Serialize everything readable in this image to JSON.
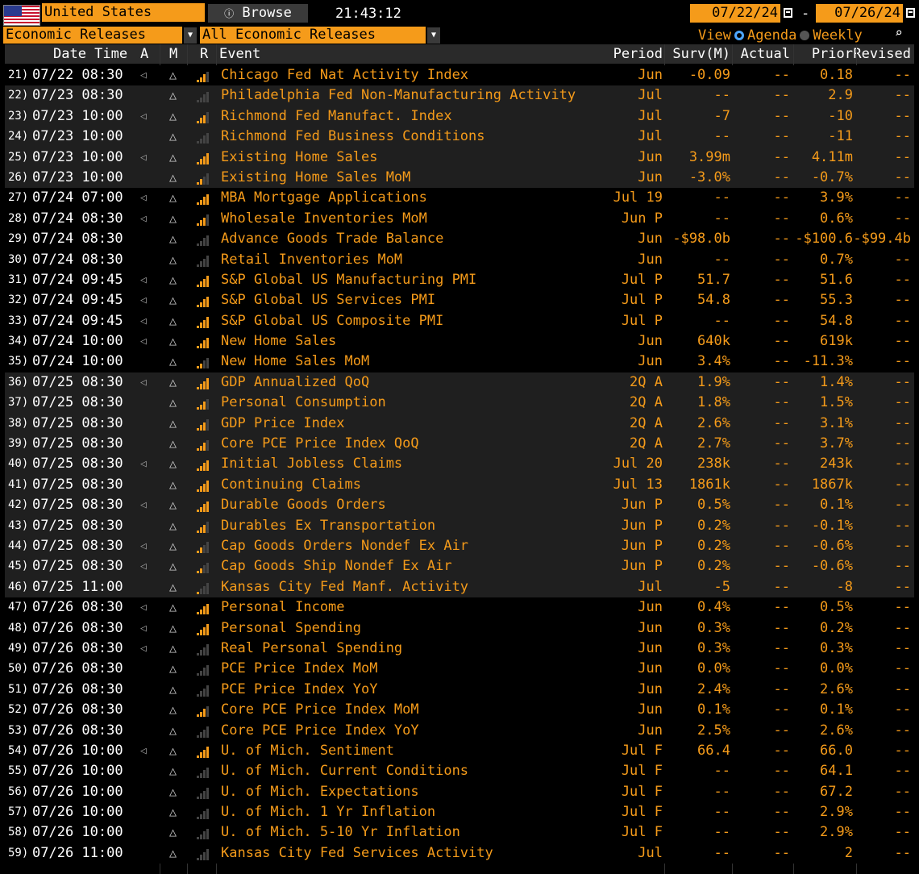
{
  "top": {
    "country": "United States",
    "browse_label": "Browse",
    "browse_icon": "info-icon",
    "time": "21:43:12",
    "date_from": "07/22/24",
    "date_sep": "-",
    "date_to": "07/26/24"
  },
  "filters": {
    "category": "Economic Releases",
    "subcategory": "All Economic Releases",
    "view_label": "View",
    "agenda_label": "Agenda",
    "weekly_label": "Weekly",
    "view_selected": "Agenda"
  },
  "columns": {
    "datetime": "Date Time",
    "a": "A",
    "m": "M",
    "r": "R",
    "event": "Event",
    "period": "Period",
    "surv": "Surv(M)",
    "actual": "Actual",
    "prior": "Prior",
    "revised": "Revised"
  },
  "rows": [
    {
      "idx": "21)",
      "dt": "07/22 08:30",
      "a": "◁",
      "r": 3,
      "event": "Chicago Fed Nat Activity Index",
      "period": "Jun",
      "surv": "-0.09",
      "actual": "--",
      "prior": "0.18",
      "revised": "--"
    },
    {
      "idx": "22)",
      "dt": "07/23 08:30",
      "a": "",
      "r": 0,
      "event": "Philadelphia Fed Non-Manufacturing Activity",
      "period": "Jul",
      "surv": "--",
      "actual": "--",
      "prior": "2.9",
      "revised": "--"
    },
    {
      "idx": "23)",
      "dt": "07/23 10:00",
      "a": "◁",
      "r": 3,
      "event": "Richmond Fed Manufact. Index",
      "period": "Jul",
      "surv": "-7",
      "actual": "--",
      "prior": "-10",
      "revised": "--"
    },
    {
      "idx": "24)",
      "dt": "07/23 10:00",
      "a": "",
      "r": 0,
      "event": "Richmond Fed Business Conditions",
      "period": "Jul",
      "surv": "--",
      "actual": "--",
      "prior": "-11",
      "revised": "--"
    },
    {
      "idx": "25)",
      "dt": "07/23 10:00",
      "a": "◁",
      "r": 4,
      "event": "Existing Home Sales",
      "period": "Jun",
      "surv": "3.99m",
      "actual": "--",
      "prior": "4.11m",
      "revised": "--"
    },
    {
      "idx": "26)",
      "dt": "07/23 10:00",
      "a": "",
      "r": 2,
      "event": "Existing Home Sales MoM",
      "period": "Jun",
      "surv": "-3.0%",
      "actual": "--",
      "prior": "-0.7%",
      "revised": "--"
    },
    {
      "idx": "27)",
      "dt": "07/24 07:00",
      "a": "◁",
      "r": 4,
      "event": "MBA Mortgage Applications",
      "period": "Jul 19",
      "surv": "--",
      "actual": "--",
      "prior": "3.9%",
      "revised": "--"
    },
    {
      "idx": "28)",
      "dt": "07/24 08:30",
      "a": "◁",
      "r": 3,
      "event": "Wholesale Inventories MoM",
      "period": "Jun P",
      "surv": "--",
      "actual": "--",
      "prior": "0.6%",
      "revised": "--"
    },
    {
      "idx": "29)",
      "dt": "07/24 08:30",
      "a": "",
      "r": 0,
      "event": "Advance Goods Trade Balance",
      "period": "Jun",
      "surv": "-$98.0b",
      "actual": "--",
      "prior": "-$100.6",
      "revised": "-$99.4b"
    },
    {
      "idx": "30)",
      "dt": "07/24 08:30",
      "a": "",
      "r": 0,
      "event": "Retail Inventories MoM",
      "period": "Jun",
      "surv": "--",
      "actual": "--",
      "prior": "0.7%",
      "revised": "--"
    },
    {
      "idx": "31)",
      "dt": "07/24 09:45",
      "a": "◁",
      "r": 4,
      "event": "S&P Global US Manufacturing PMI",
      "period": "Jul P",
      "surv": "51.7",
      "actual": "--",
      "prior": "51.6",
      "revised": "--"
    },
    {
      "idx": "32)",
      "dt": "07/24 09:45",
      "a": "◁",
      "r": 4,
      "event": "S&P Global US Services PMI",
      "period": "Jul P",
      "surv": "54.8",
      "actual": "--",
      "prior": "55.3",
      "revised": "--"
    },
    {
      "idx": "33)",
      "dt": "07/24 09:45",
      "a": "◁",
      "r": 4,
      "event": "S&P Global US Composite PMI",
      "period": "Jul P",
      "surv": "--",
      "actual": "--",
      "prior": "54.8",
      "revised": "--"
    },
    {
      "idx": "34)",
      "dt": "07/24 10:00",
      "a": "◁",
      "r": 4,
      "event": "New Home Sales",
      "period": "Jun",
      "surv": "640k",
      "actual": "--",
      "prior": "619k",
      "revised": "--"
    },
    {
      "idx": "35)",
      "dt": "07/24 10:00",
      "a": "",
      "r": 2,
      "event": "New Home Sales MoM",
      "period": "Jun",
      "surv": "3.4%",
      "actual": "--",
      "prior": "-11.3%",
      "revised": "--"
    },
    {
      "idx": "36)",
      "dt": "07/25 08:30",
      "a": "◁",
      "r": 4,
      "event": "GDP Annualized QoQ",
      "period": "2Q A",
      "surv": "1.9%",
      "actual": "--",
      "prior": "1.4%",
      "revised": "--"
    },
    {
      "idx": "37)",
      "dt": "07/25 08:30",
      "a": "",
      "r": 3,
      "event": "Personal Consumption",
      "period": "2Q A",
      "surv": "1.8%",
      "actual": "--",
      "prior": "1.5%",
      "revised": "--"
    },
    {
      "idx": "38)",
      "dt": "07/25 08:30",
      "a": "",
      "r": 3,
      "event": "GDP Price Index",
      "period": "2Q A",
      "surv": "2.6%",
      "actual": "--",
      "prior": "3.1%",
      "revised": "--"
    },
    {
      "idx": "39)",
      "dt": "07/25 08:30",
      "a": "",
      "r": 3,
      "event": "Core PCE Price Index QoQ",
      "period": "2Q A",
      "surv": "2.7%",
      "actual": "--",
      "prior": "3.7%",
      "revised": "--"
    },
    {
      "idx": "40)",
      "dt": "07/25 08:30",
      "a": "◁",
      "r": 4,
      "event": "Initial Jobless Claims",
      "period": "Jul 20",
      "surv": "238k",
      "actual": "--",
      "prior": "243k",
      "revised": "--"
    },
    {
      "idx": "41)",
      "dt": "07/25 08:30",
      "a": "",
      "r": 4,
      "event": "Continuing Claims",
      "period": "Jul 13",
      "surv": "1861k",
      "actual": "--",
      "prior": "1867k",
      "revised": "--"
    },
    {
      "idx": "42)",
      "dt": "07/25 08:30",
      "a": "◁",
      "r": 4,
      "event": "Durable Goods Orders",
      "period": "Jun P",
      "surv": "0.5%",
      "actual": "--",
      "prior": "0.1%",
      "revised": "--"
    },
    {
      "idx": "43)",
      "dt": "07/25 08:30",
      "a": "",
      "r": 3,
      "event": "Durables Ex Transportation",
      "period": "Jun P",
      "surv": "0.2%",
      "actual": "--",
      "prior": "-0.1%",
      "revised": "--"
    },
    {
      "idx": "44)",
      "dt": "07/25 08:30",
      "a": "◁",
      "r": 2,
      "event": "Cap Goods Orders Nondef Ex Air",
      "period": "Jun P",
      "surv": "0.2%",
      "actual": "--",
      "prior": "-0.6%",
      "revised": "--"
    },
    {
      "idx": "45)",
      "dt": "07/25 08:30",
      "a": "◁",
      "r": 2,
      "event": "Cap Goods Ship Nondef Ex Air",
      "period": "Jun P",
      "surv": "0.2%",
      "actual": "--",
      "prior": "-0.6%",
      "revised": "--"
    },
    {
      "idx": "46)",
      "dt": "07/25 11:00",
      "a": "",
      "r": 1,
      "event": "Kansas City Fed Manf. Activity",
      "period": "Jul",
      "surv": "-5",
      "actual": "--",
      "prior": "-8",
      "revised": "--"
    },
    {
      "idx": "47)",
      "dt": "07/26 08:30",
      "a": "◁",
      "r": 4,
      "event": "Personal Income",
      "period": "Jun",
      "surv": "0.4%",
      "actual": "--",
      "prior": "0.5%",
      "revised": "--"
    },
    {
      "idx": "48)",
      "dt": "07/26 08:30",
      "a": "◁",
      "r": 4,
      "event": "Personal Spending",
      "period": "Jun",
      "surv": "0.3%",
      "actual": "--",
      "prior": "0.2%",
      "revised": "--"
    },
    {
      "idx": "49)",
      "dt": "07/26 08:30",
      "a": "◁",
      "r": 0,
      "event": "Real Personal Spending",
      "period": "Jun",
      "surv": "0.3%",
      "actual": "--",
      "prior": "0.3%",
      "revised": "--"
    },
    {
      "idx": "50)",
      "dt": "07/26 08:30",
      "a": "",
      "r": 0,
      "event": "PCE Price Index MoM",
      "period": "Jun",
      "surv": "0.0%",
      "actual": "--",
      "prior": "0.0%",
      "revised": "--"
    },
    {
      "idx": "51)",
      "dt": "07/26 08:30",
      "a": "",
      "r": 0,
      "event": "PCE Price Index YoY",
      "period": "Jun",
      "surv": "2.4%",
      "actual": "--",
      "prior": "2.6%",
      "revised": "--"
    },
    {
      "idx": "52)",
      "dt": "07/26 08:30",
      "a": "",
      "r": 3,
      "event": "Core PCE Price Index MoM",
      "period": "Jun",
      "surv": "0.1%",
      "actual": "--",
      "prior": "0.1%",
      "revised": "--"
    },
    {
      "idx": "53)",
      "dt": "07/26 08:30",
      "a": "",
      "r": 0,
      "event": "Core PCE Price Index YoY",
      "period": "Jun",
      "surv": "2.5%",
      "actual": "--",
      "prior": "2.6%",
      "revised": "--"
    },
    {
      "idx": "54)",
      "dt": "07/26 10:00",
      "a": "◁",
      "r": 4,
      "event": "U. of Mich. Sentiment",
      "period": "Jul F",
      "surv": "66.4",
      "actual": "--",
      "prior": "66.0",
      "revised": "--"
    },
    {
      "idx": "55)",
      "dt": "07/26 10:00",
      "a": "",
      "r": 0,
      "event": "U. of Mich. Current Conditions",
      "period": "Jul F",
      "surv": "--",
      "actual": "--",
      "prior": "64.1",
      "revised": "--"
    },
    {
      "idx": "56)",
      "dt": "07/26 10:00",
      "a": "",
      "r": 0,
      "event": "U. of Mich. Expectations",
      "period": "Jul F",
      "surv": "--",
      "actual": "--",
      "prior": "67.2",
      "revised": "--"
    },
    {
      "idx": "57)",
      "dt": "07/26 10:00",
      "a": "",
      "r": 0,
      "event": "U. of Mich. 1 Yr Inflation",
      "period": "Jul F",
      "surv": "--",
      "actual": "--",
      "prior": "2.9%",
      "revised": "--"
    },
    {
      "idx": "58)",
      "dt": "07/26 10:00",
      "a": "",
      "r": 0,
      "event": "U. of Mich. 5-10 Yr Inflation",
      "period": "Jul F",
      "surv": "--",
      "actual": "--",
      "prior": "2.9%",
      "revised": "--"
    },
    {
      "idx": "59)",
      "dt": "07/26 11:00",
      "a": "",
      "r": 0,
      "event": "Kansas City Fed Services Activity",
      "period": "Jul",
      "surv": "--",
      "actual": "--",
      "prior": "2",
      "revised": "--"
    }
  ],
  "colors": {
    "accent": "#f59b1a",
    "row_alt": "#1f1f1f",
    "header_bg": "#2a2a2a",
    "relevance_off": "#444444"
  }
}
